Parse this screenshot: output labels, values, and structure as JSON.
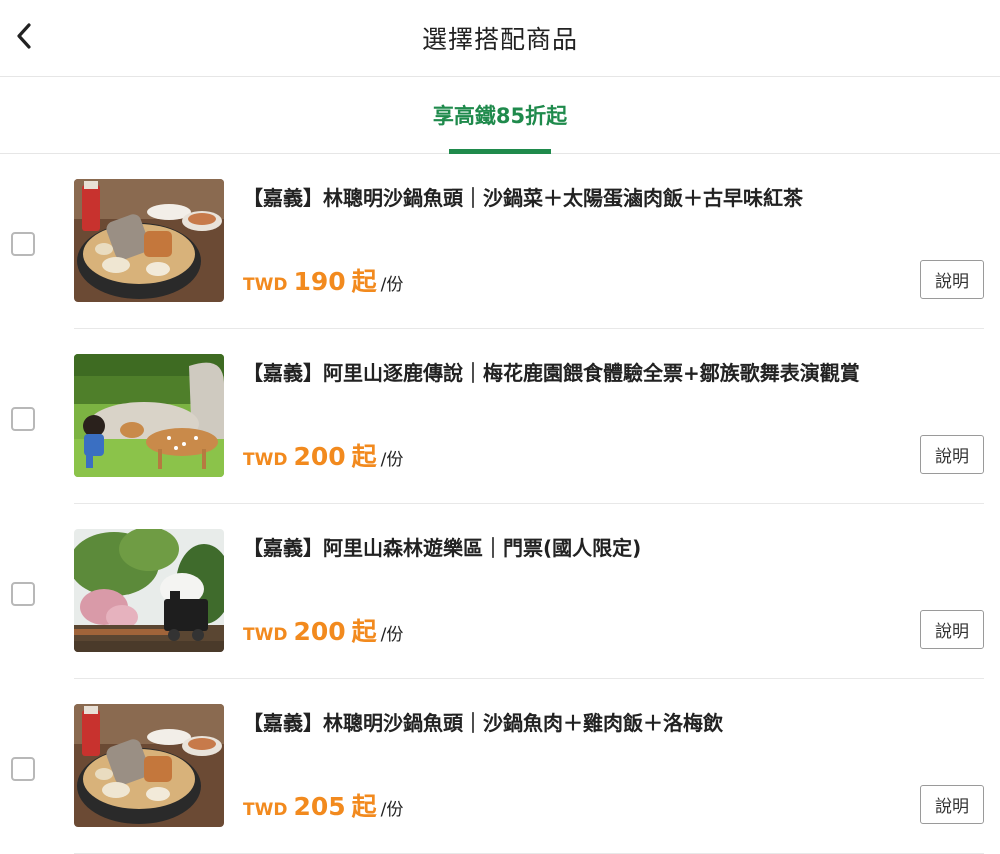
{
  "header": {
    "title": "選擇搭配商品",
    "back_icon": "chevron-left-icon"
  },
  "tabs": [
    {
      "label": "享高鐵85折起",
      "active": true
    }
  ],
  "colors": {
    "accent_green": "#1f8a4c",
    "price_orange": "#f28a1e"
  },
  "products": [
    {
      "name": "【嘉義】林聰明沙鍋魚頭｜沙鍋菜＋太陽蛋滷肉飯＋古早味紅茶",
      "currency": "TWD",
      "price": "190",
      "from": "起",
      "unit": "/份",
      "button": "說明",
      "checked": false,
      "image": "fish-head-hotpot-photo"
    },
    {
      "name": "【嘉義】阿里山逐鹿傳說｜梅花鹿園餵食體驗全票+鄒族歌舞表演觀賞",
      "currency": "TWD",
      "price": "200",
      "from": "起",
      "unit": "/份",
      "button": "說明",
      "checked": false,
      "image": "child-and-deer-photo"
    },
    {
      "name": "【嘉義】阿里山森林遊樂區｜門票(國人限定)",
      "currency": "TWD",
      "price": "200",
      "from": "起",
      "unit": "/份",
      "button": "說明",
      "checked": false,
      "image": "forest-train-photo"
    },
    {
      "name": "【嘉義】林聰明沙鍋魚頭｜沙鍋魚肉＋雞肉飯＋洛梅飲",
      "currency": "TWD",
      "price": "205",
      "from": "起",
      "unit": "/份",
      "button": "說明",
      "checked": false,
      "image": "fish-head-hotpot-photo"
    }
  ]
}
